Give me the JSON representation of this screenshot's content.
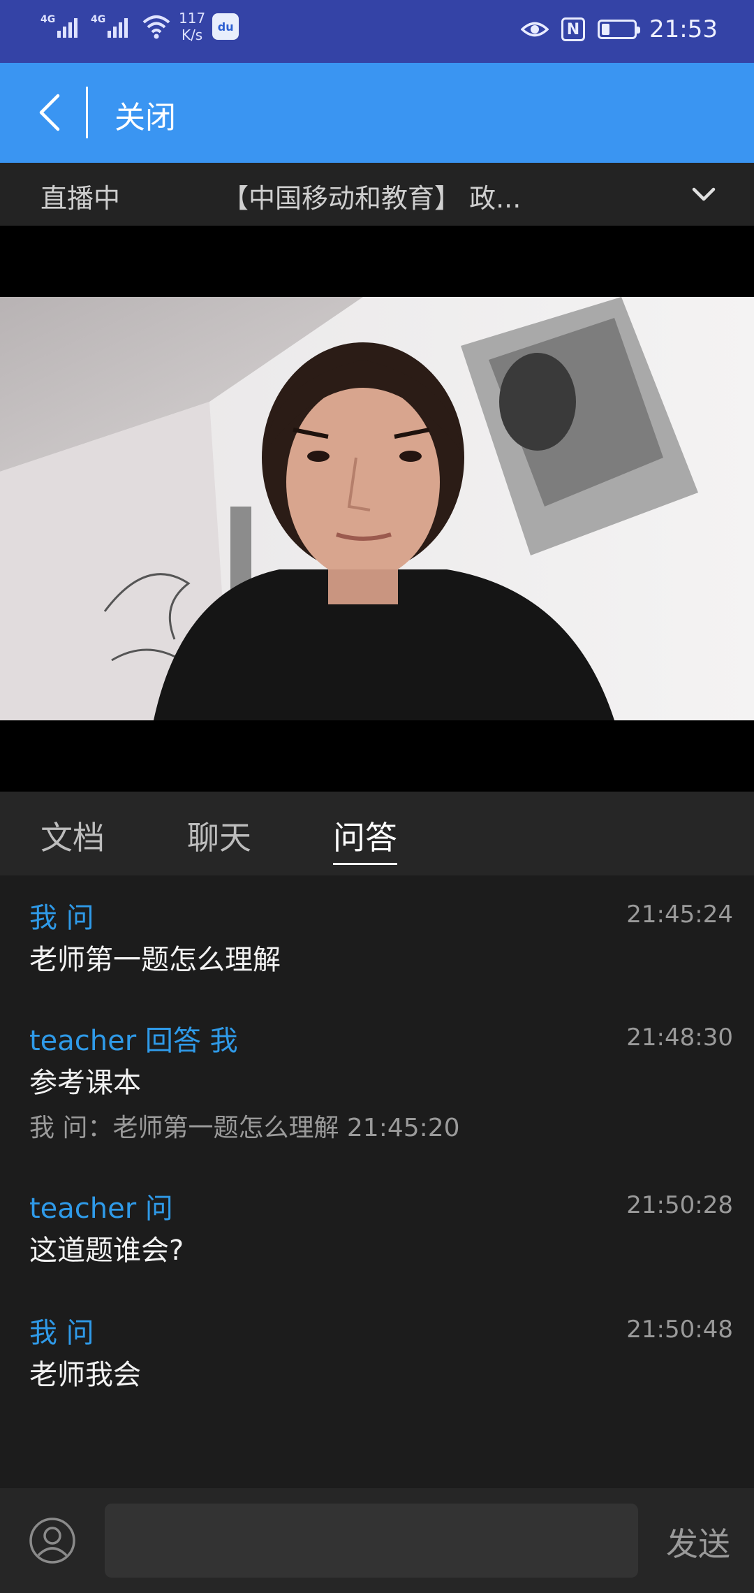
{
  "status_bar": {
    "network_1": "4G",
    "network_2": "4G",
    "speed_value": "117",
    "speed_unit": "K/s",
    "app_badge": "du",
    "time": "21:53",
    "nfc": "N",
    "battery_level": 0.25,
    "icons": [
      "signal-icon",
      "signal-icon",
      "wifi-icon",
      "app-badge-icon",
      "eye-icon",
      "nfc-icon",
      "battery-icon"
    ]
  },
  "nav": {
    "back_icon": "chevron-left-icon",
    "close_label": "关闭",
    "background": "#3a95f2"
  },
  "live": {
    "status": "直播中",
    "title": "【中国移动和教育】 政...",
    "expand_icon": "chevron-down-icon"
  },
  "tabs": [
    {
      "label": "文档",
      "active": false
    },
    {
      "label": "聊天",
      "active": false
    },
    {
      "label": "问答",
      "active": true
    }
  ],
  "messages": [
    {
      "sender": "我 问",
      "time": "21:45:24",
      "text": "老师第一题怎么理解",
      "quote": ""
    },
    {
      "sender": "teacher 回答 我",
      "time": "21:48:30",
      "text": "参考课本",
      "quote": "我 问：老师第一题怎么理解 21:45:20"
    },
    {
      "sender": "teacher 问",
      "time": "21:50:28",
      "text": "这道题谁会?",
      "quote": ""
    },
    {
      "sender": "我 问",
      "time": "21:50:48",
      "text": "老师我会",
      "quote": ""
    }
  ],
  "input": {
    "value": "",
    "placeholder": "",
    "send_label": "发送",
    "avatar_icon": "user-avatar-icon"
  },
  "colors": {
    "status_bar": "#3443a6",
    "accent_blue": "#2f9ae8",
    "dark_bg": "#1c1c1c"
  }
}
